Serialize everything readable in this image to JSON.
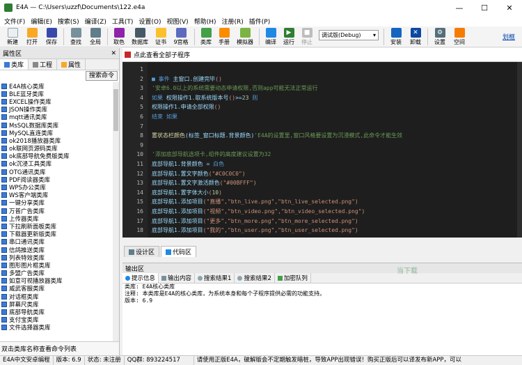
{
  "window": {
    "title": "E4A — C:\\Users\\uzzf\\Documents\\122.e4a",
    "minimize": "—",
    "maximize": "☐",
    "close": "✕"
  },
  "menu": [
    "文件(F)",
    "编辑(E)",
    "搜索(S)",
    "编译(Z)",
    "工具(T)",
    "设置(O)",
    "视图(V)",
    "帮助(H)",
    "注册(R)",
    "插件(P)"
  ],
  "toolbar": {
    "new": "新建",
    "open": "打开",
    "save": "保存",
    "find": "查找",
    "global": "全局",
    "colorpick": "取色",
    "database": "数据库",
    "cert": "证书",
    "nine_grid": "9宫格",
    "library": "类库",
    "manual": "手册",
    "simulator": "模拟器",
    "compile": "编译",
    "run": "运行",
    "stop": "停止",
    "build_mode": "调试版(Debug)",
    "install": "安装",
    "uninstall": "卸载",
    "settings": "设置",
    "space": "空间",
    "clear": "划框"
  },
  "left_panel": {
    "title": "属性区",
    "close": "✕",
    "tabs": [
      "类库",
      "工程",
      "属性"
    ],
    "search_button": "搜索命令",
    "items": [
      "E4A核心类库",
      "BLE蓝牙类库",
      "EXCEL操作类库",
      "JSON操作类库",
      "mqtt通讯类库",
      "MsSQL数据库类库",
      "MySQL直连类库",
      "ok2018播放器类库",
      "ok联网页源码类库",
      "ok底部导航免费版类库",
      "ok沉浸工具类库",
      "OTG通讯类库",
      "PDF阅读器类库",
      "WPS办公类库",
      "WS客户端类库",
      "一键分享类库",
      "万普广告类库",
      "上传器类库",
      "下拉刷新面板类库",
      "下载器更新版类库",
      "串口通讯类库",
      "信鸽推送类库",
      "列表特效类库",
      "图形图片框类库",
      "多盟广告类库",
      "如意可视播放器类库",
      "威武客服类库",
      "对话框类库",
      "屏幕尺类库",
      "底部导航类库",
      "支付宝类库",
      "文件选择器类库"
    ],
    "hint": "双击类库名称查看命令列表"
  },
  "doc_header": "点此查看全部子程序",
  "editor": {
    "lines": [
      {
        "n": "1",
        "parts": []
      },
      {
        "n": "2",
        "parts": [
          {
            "c": "c-kw",
            "t": "■ 事件 "
          },
          {
            "c": "c-txt",
            "t": "主窗口.创建完毕"
          },
          {
            "c": "c-str",
            "t": "()"
          }
        ]
      },
      {
        "n": "3",
        "parts": [
          {
            "c": "c-cm",
            "t": "  '安卓6.0以上的系统需要动态申请权限,否则app可能无法正常运行"
          }
        ]
      },
      {
        "n": "4",
        "parts": [
          {
            "c": "c-kw",
            "t": "  如果 "
          },
          {
            "c": "c-txt",
            "t": "权限操作1.取系统版本号"
          },
          {
            "c": "c-str",
            "t": "()"
          },
          {
            "c": "c-txt",
            "t": ">="
          },
          {
            "c": "c-num",
            "t": "23"
          },
          {
            "c": "c-kw",
            "t": " 则"
          }
        ]
      },
      {
        "n": "5",
        "parts": [
          {
            "c": "c-txt",
            "t": "       权限操作1.申请全部权限"
          },
          {
            "c": "c-str",
            "t": "()"
          }
        ]
      },
      {
        "n": "6",
        "parts": [
          {
            "c": "c-kw",
            "t": "  结束 如果"
          }
        ]
      },
      {
        "n": "7",
        "parts": []
      },
      {
        "n": "8",
        "parts": [
          {
            "c": "c-fn",
            "t": "  置状态栏颜色"
          },
          {
            "c": "c-txt",
            "t": "(标签_窗口标题.背景颜色)"
          },
          {
            "c": "c-cm",
            "t": "'E4A的设置里,窗口风格要设置为沉浸模式,此命令才能生效"
          }
        ]
      },
      {
        "n": "9",
        "parts": []
      },
      {
        "n": "10",
        "parts": [
          {
            "c": "c-cm",
            "t": "  '添加底部导航选项卡,组件的高度建议设置为32"
          }
        ]
      },
      {
        "n": "11",
        "parts": [
          {
            "c": "c-txt",
            "t": "  底部导航1.背景颜色 = "
          },
          {
            "c": "c-kw",
            "t": "白色"
          }
        ]
      },
      {
        "n": "12",
        "parts": [
          {
            "c": "c-txt",
            "t": "  底部导航1.置文字颜色"
          },
          {
            "c": "c-str",
            "t": "(\"#C0C0C0\")"
          }
        ]
      },
      {
        "n": "13",
        "parts": [
          {
            "c": "c-txt",
            "t": "  底部导航1.置文字激活颜色"
          },
          {
            "c": "c-str",
            "t": "(\"#00BFFF\")"
          }
        ]
      },
      {
        "n": "14",
        "parts": [
          {
            "c": "c-txt",
            "t": "  底部导航1.置字体大小"
          },
          {
            "c": "c-str",
            "t": "("
          },
          {
            "c": "c-num",
            "t": "10"
          },
          {
            "c": "c-str",
            "t": ")"
          }
        ]
      },
      {
        "n": "15",
        "parts": [
          {
            "c": "c-txt",
            "t": "  底部导航1.添加项目"
          },
          {
            "c": "c-str",
            "t": "(\"直播\",\"btn_live.png\",\"btn_live_selected.png\")"
          }
        ]
      },
      {
        "n": "16",
        "parts": [
          {
            "c": "c-txt",
            "t": "  底部导航1.添加项目"
          },
          {
            "c": "c-str",
            "t": "(\"视频\",\"btn_video.png\",\"btn_video_selected.png\")"
          }
        ]
      },
      {
        "n": "17",
        "parts": [
          {
            "c": "c-txt",
            "t": "  底部导航1.添加项目"
          },
          {
            "c": "c-str",
            "t": "(\"更多\",\"btn_more.png\",\"btn_more_selected.png\")"
          }
        ]
      },
      {
        "n": "18",
        "parts": [
          {
            "c": "c-txt",
            "t": "  底部导航1.添加项目"
          },
          {
            "c": "c-str",
            "t": "(\"我的\",\"btn_user.png\",\"btn_user_selected.png\")"
          }
        ]
      }
    ]
  },
  "view_tabs": [
    "设计区",
    "代码区"
  ],
  "output": {
    "title": "输出区",
    "tabs": [
      "提示信息",
      "输出内容",
      "搜索结果1",
      "搜索结果2",
      "加密队列"
    ],
    "lines": [
      "类库: E4A核心类库",
      "注释: 本类库是E4A的核心类库，为系统本身和每个子程序提供必需的功能支持。",
      "版本: 6.9"
    ],
    "watermark": "当下载"
  },
  "status": {
    "product": "E4A中文安卓编程",
    "version": "版本: 6.9",
    "state": "状态: 未注册",
    "qq": "QQ群: 893224517",
    "notice": "请使用正版E4A，破解版会不定期触发暗桩，导致APP出现错误！购买正版后可以译发布新APP，可以"
  }
}
